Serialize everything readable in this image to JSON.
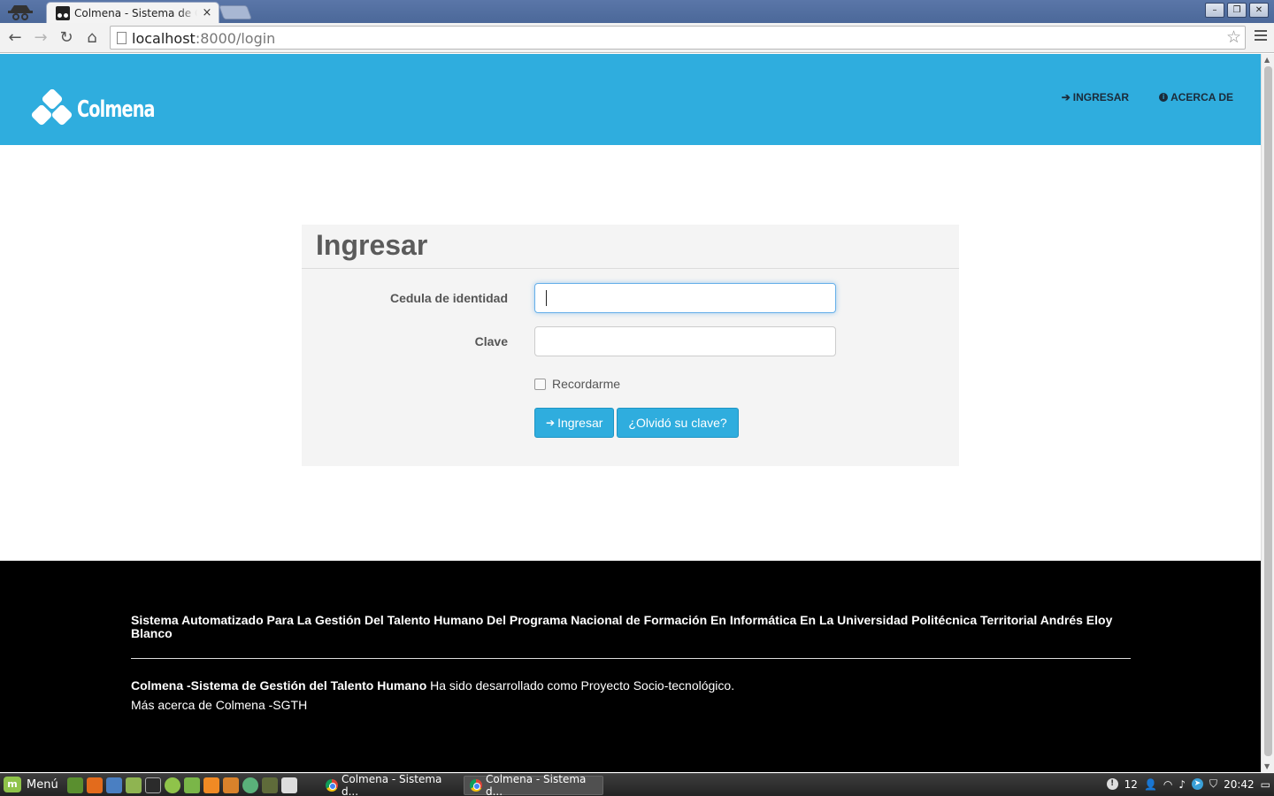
{
  "browser": {
    "tab_title": "Colmena - Sistema de Ge",
    "tab_close": "×",
    "url_host": "localhost",
    "url_path": ":8000/login",
    "window_controls": [
      "–",
      "❐",
      "✕"
    ]
  },
  "navbar": {
    "brand": "Colmena",
    "links": [
      {
        "label": "INGRESAR",
        "icon": "sign-in-icon"
      },
      {
        "label": "ACERCA DE",
        "icon": "info-icon"
      }
    ],
    "color": "#2fadde"
  },
  "login": {
    "title": "Ingresar",
    "cedula_label": "Cedula de identidad",
    "clave_label": "Clave",
    "remember_label": "Recordarme",
    "submit_label": "Ingresar",
    "forgot_label": "¿Olvidó su clave?"
  },
  "footer": {
    "title": "Sistema Automatizado Para La Gestión Del Talento Humano Del Programa Nacional de Formación En Informática En La Universidad Politécnica Territorial Andrés Eloy Blanco",
    "desc_bold": "Colmena -Sistema de Gestión del Talento Humano",
    "desc_text": " Ha sido desarrollado como Proyecto Socio-tecnológico.",
    "more": "Más acerca de Colmena -SGTH"
  },
  "taskbar": {
    "menu_label": "Menú",
    "tasks": [
      "Colmena - Sistema d...",
      "Colmena - Sistema d..."
    ],
    "tray_count": "12",
    "clock": "20:42"
  }
}
